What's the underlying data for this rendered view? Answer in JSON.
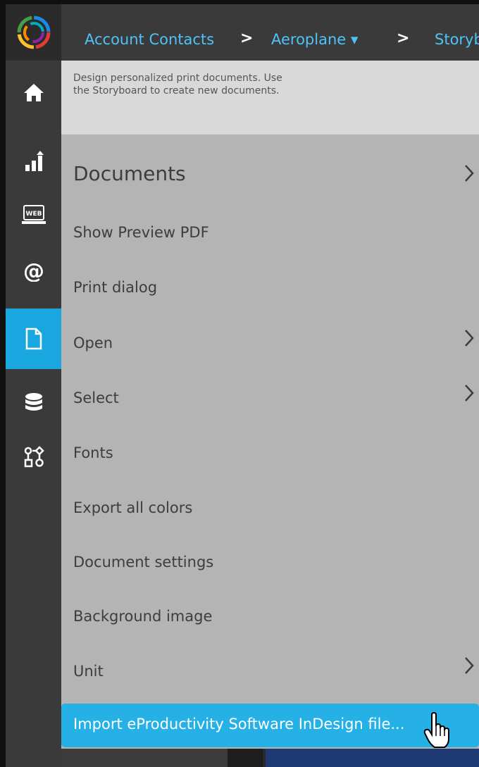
{
  "breadcrumb": {
    "items": [
      "Account Contacts",
      "Aeroplane ▾",
      "Storyb"
    ]
  },
  "panel": {
    "description": "Design personalized print documents. Use the Storyboard to create new documents.",
    "heading": "Documents",
    "items": [
      {
        "label": "Show Preview PDF",
        "submenu": false
      },
      {
        "label": "Print dialog",
        "submenu": false
      },
      {
        "label": "Open",
        "submenu": true
      },
      {
        "label": "Select",
        "submenu": true
      },
      {
        "label": "Fonts",
        "submenu": false
      },
      {
        "label": "Export all colors",
        "submenu": false
      },
      {
        "label": "Document settings",
        "submenu": false
      },
      {
        "label": "Background image",
        "submenu": false
      },
      {
        "label": "Unit",
        "submenu": true
      }
    ],
    "highlighted": "Import eProductivity Software InDesign file..."
  },
  "rail": {
    "items": [
      "home-icon",
      "chart-icon",
      "web-icon",
      "email-icon",
      "document-icon",
      "database-icon",
      "workflow-icon"
    ],
    "active": "document-icon",
    "web_badge": "WEB"
  },
  "colors": {
    "accent": "#1aa6de",
    "rail": "#3a3a3a",
    "panel": "#b4b4b4",
    "crumb": "#4fc3f7"
  }
}
